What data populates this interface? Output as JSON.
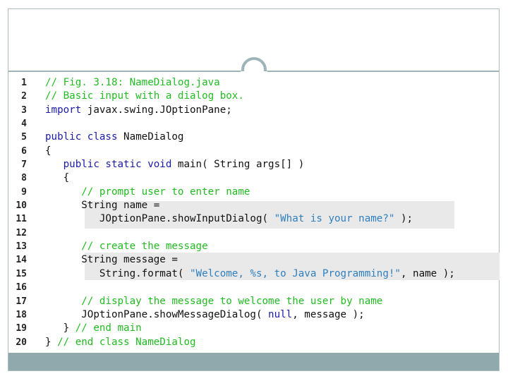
{
  "code": {
    "line_numbers": [
      "1",
      "2",
      "3",
      "4",
      "5",
      "6",
      "7",
      "8",
      "9",
      "10",
      "11",
      "12",
      "13",
      "14",
      "15",
      "16",
      "17",
      "18",
      "19",
      "20"
    ],
    "lines": [
      {
        "parts": [
          {
            "t": "// Fig. 3.18: NameDialog.java",
            "c": "cm"
          }
        ]
      },
      {
        "parts": [
          {
            "t": "// Basic input with a dialog box.",
            "c": "cm"
          }
        ]
      },
      {
        "parts": [
          {
            "t": "import",
            "c": "kw"
          },
          {
            "t": " javax.swing.JOptionPane;",
            "c": ""
          }
        ]
      },
      {
        "parts": []
      },
      {
        "parts": [
          {
            "t": "public class",
            "c": "kw"
          },
          {
            "t": " NameDialog",
            "c": ""
          }
        ]
      },
      {
        "parts": [
          {
            "t": "{",
            "c": ""
          }
        ]
      },
      {
        "parts": [
          {
            "t": "   ",
            "c": ""
          },
          {
            "t": "public static void",
            "c": "kw"
          },
          {
            "t": " main( String args[] )",
            "c": ""
          }
        ]
      },
      {
        "parts": [
          {
            "t": "   {",
            "c": ""
          }
        ]
      },
      {
        "parts": [
          {
            "t": "      ",
            "c": ""
          },
          {
            "t": "// prompt user to enter name",
            "c": "cm"
          }
        ]
      },
      {
        "parts": [
          {
            "t": "      String name =",
            "c": ""
          }
        ]
      },
      {
        "parts": [
          {
            "t": "         JOptionPane.showInputDialog( ",
            "c": ""
          },
          {
            "t": "\"What is your name?\"",
            "c": "st"
          },
          {
            "t": " );",
            "c": ""
          }
        ]
      },
      {
        "parts": []
      },
      {
        "parts": [
          {
            "t": "      ",
            "c": ""
          },
          {
            "t": "// create the message",
            "c": "cm"
          }
        ]
      },
      {
        "parts": [
          {
            "t": "      String message =",
            "c": ""
          }
        ]
      },
      {
        "parts": [
          {
            "t": "         String.format( ",
            "c": ""
          },
          {
            "t": "\"Welcome, %s, to Java Programming!\"",
            "c": "st"
          },
          {
            "t": ", name );",
            "c": ""
          }
        ]
      },
      {
        "parts": []
      },
      {
        "parts": [
          {
            "t": "      ",
            "c": ""
          },
          {
            "t": "// display the message to welcome the user by name",
            "c": "cm"
          }
        ]
      },
      {
        "parts": [
          {
            "t": "      JOptionPane.showMessageDialog( ",
            "c": ""
          },
          {
            "t": "null",
            "c": "kw"
          },
          {
            "t": ", message );",
            "c": ""
          }
        ]
      },
      {
        "parts": [
          {
            "t": "   } ",
            "c": ""
          },
          {
            "t": "// end main",
            "c": "cm"
          }
        ]
      },
      {
        "parts": [
          {
            "t": "} ",
            "c": ""
          },
          {
            "t": "// end class NameDialog",
            "c": "cm"
          }
        ]
      }
    ]
  },
  "colors": {
    "comment": "#22bb22",
    "keyword": "#1a1aaa",
    "string": "#2f7fbf",
    "highlight": "#e9e9e9",
    "accent_bar": "#8fa9ad"
  }
}
